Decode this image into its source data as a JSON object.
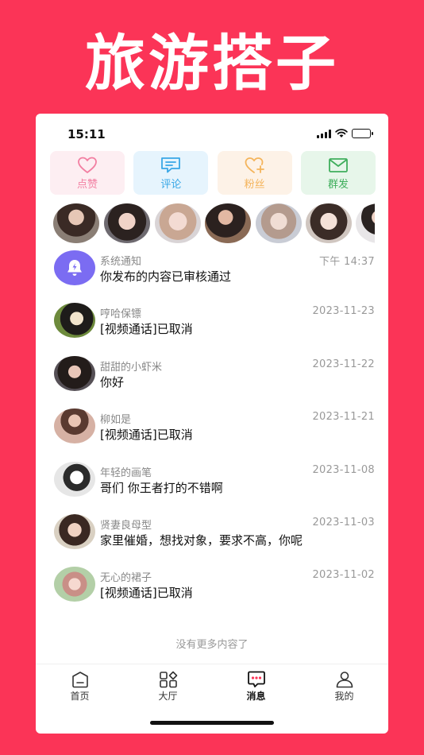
{
  "headline": "旅游搭子",
  "status_bar": {
    "time": "15:11"
  },
  "actions": [
    {
      "label": "点赞",
      "icon": "heart-icon",
      "color": "#f27fa2"
    },
    {
      "label": "评论",
      "icon": "comment-icon",
      "color": "#39a7e6"
    },
    {
      "label": "粉丝",
      "icon": "heart-plus-icon",
      "color": "#f4b45b"
    },
    {
      "label": "群发",
      "icon": "mail-icon",
      "color": "#3fae5c"
    }
  ],
  "messages": [
    {
      "name": "系统通知",
      "date": "下午 14:37",
      "text": "你发布的内容已审核通过"
    },
    {
      "name": "哼哈保镖",
      "date": "2023-11-23",
      "text": "[视频通话]已取消"
    },
    {
      "name": "甜甜的小虾米",
      "date": "2023-11-22",
      "text": "你好"
    },
    {
      "name": "柳如是",
      "date": "2023-11-21",
      "text": "[视频通话]已取消"
    },
    {
      "name": "年轻的画笔",
      "date": "2023-11-08",
      "text": "哥们 你王者打的不错啊"
    },
    {
      "name": "贤妻良母型",
      "date": "2023-11-03",
      "text": "家里催婚，想找对象，要求不高，你呢"
    },
    {
      "name": "无心的裙子",
      "date": "2023-11-02",
      "text": "[视频通话]已取消"
    }
  ],
  "no_more_text": "没有更多内容了",
  "tabs": [
    {
      "label": "首页"
    },
    {
      "label": "大厅"
    },
    {
      "label": "消息"
    },
    {
      "label": "我的"
    }
  ],
  "colors": {
    "brand": "#fb3457",
    "system_notice": "#7b6cf2",
    "tab_active": "#fb3457"
  }
}
